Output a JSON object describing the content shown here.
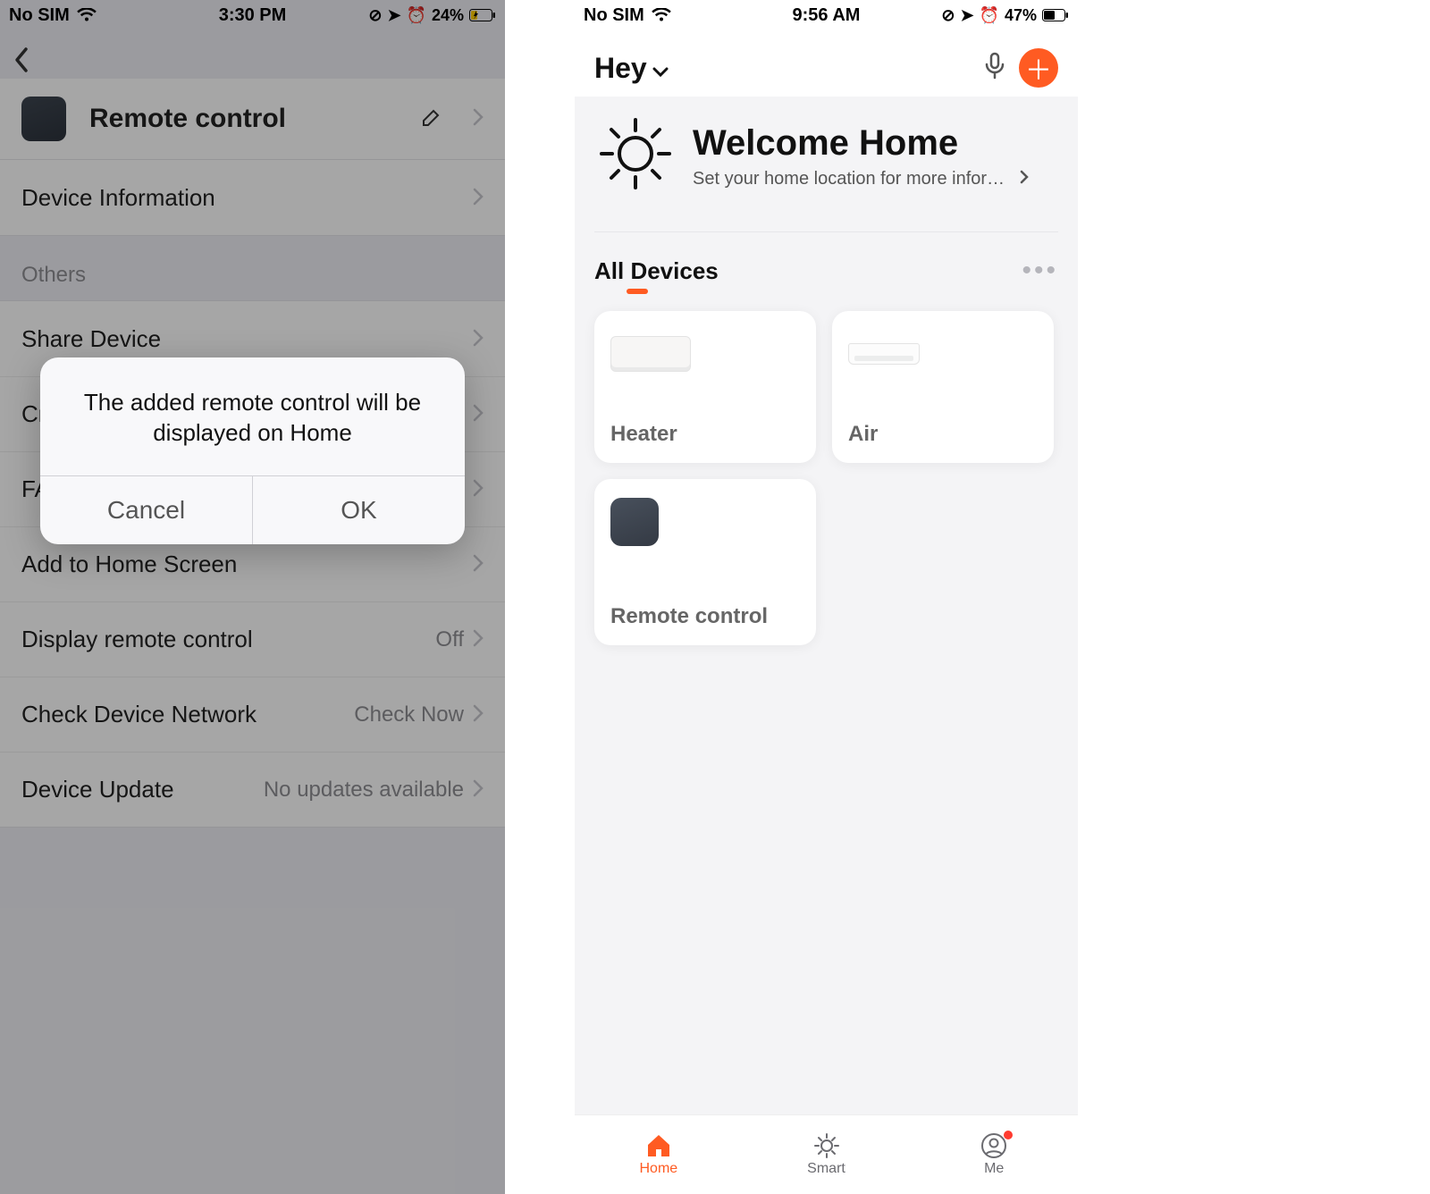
{
  "left": {
    "status": {
      "carrier": "No SIM",
      "time": "3:30 PM",
      "battery": "24%"
    },
    "title": "Remote control",
    "items": {
      "device_info": "Device Information",
      "section_others": "Others",
      "share_device": "Share Device",
      "create_group": "Cr",
      "faq": "FA",
      "add_home_screen": "Add to Home Screen",
      "display_remote": "Display remote control",
      "display_remote_value": "Off",
      "check_network": "Check Device Network",
      "check_network_value": "Check Now",
      "device_update": "Device Update",
      "device_update_value": "No updates available"
    },
    "dialog": {
      "message": "The added remote control will be displayed on Home",
      "cancel": "Cancel",
      "ok": "OK"
    }
  },
  "right": {
    "status": {
      "carrier": "No SIM",
      "time": "9:56 AM",
      "battery": "47%"
    },
    "header": {
      "greeting": "Hey"
    },
    "welcome": {
      "title": "Welcome Home",
      "subtitle": "Set your home location for more informa…"
    },
    "tab": "All Devices",
    "devices": [
      {
        "name": "Heater"
      },
      {
        "name": "Air"
      },
      {
        "name": "Remote control"
      }
    ],
    "tabbar": {
      "home": "Home",
      "smart": "Smart",
      "me": "Me"
    }
  }
}
